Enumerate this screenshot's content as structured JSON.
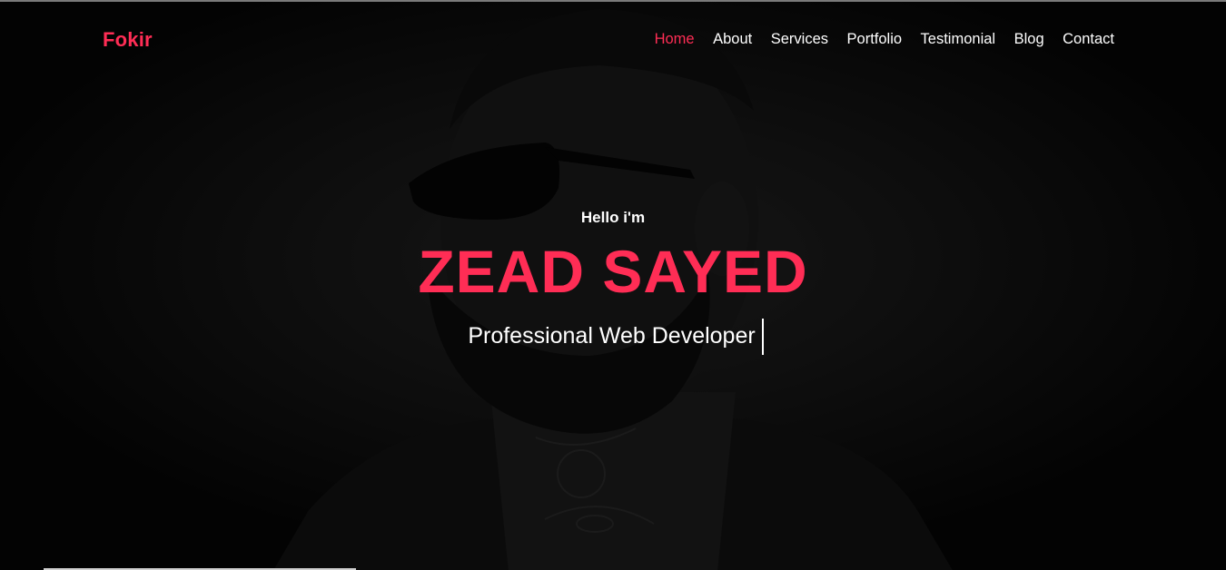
{
  "logo": {
    "text": "Fokir"
  },
  "nav": {
    "items": [
      {
        "label": "Home",
        "active": true
      },
      {
        "label": "About",
        "active": false
      },
      {
        "label": "Services",
        "active": false
      },
      {
        "label": "Portfolio",
        "active": false
      },
      {
        "label": "Testimonial",
        "active": false
      },
      {
        "label": "Blog",
        "active": false
      },
      {
        "label": "Contact",
        "active": false
      }
    ]
  },
  "hero": {
    "greeting": "Hello i'm",
    "name": "ZEAD SAYED",
    "role": "Professional Web Developer",
    "background_image": "dark portrait of bearded man with sunglasses and tattoos"
  },
  "colors": {
    "accent": "#ff2d55",
    "text": "#ffffff",
    "background": "#0a0a0a"
  }
}
